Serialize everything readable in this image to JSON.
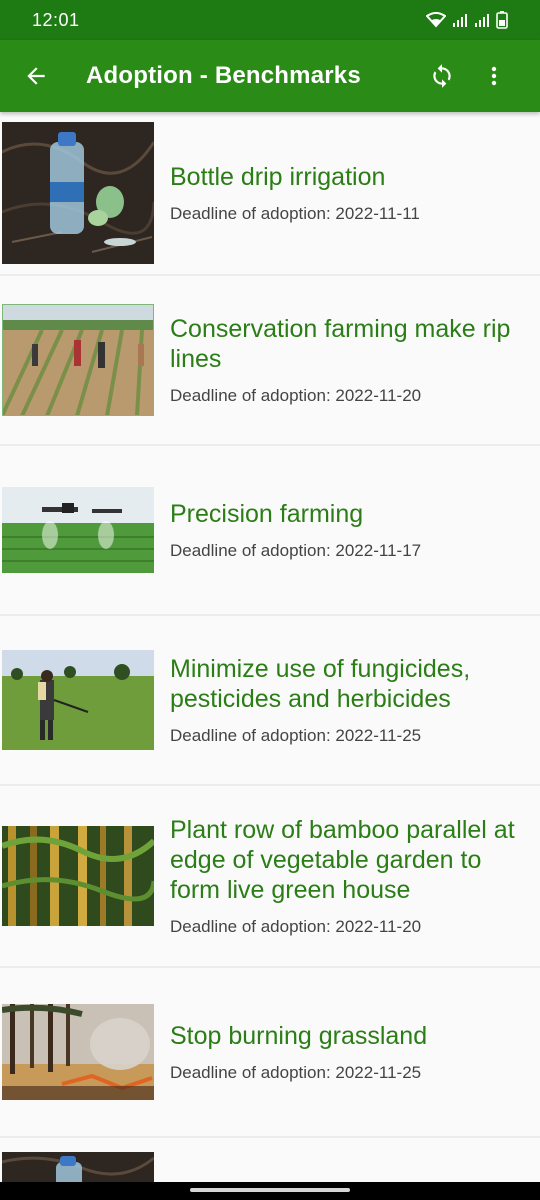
{
  "status_bar": {
    "time": "12:01",
    "icons": [
      "wifi-icon",
      "signal-icon",
      "signal-icon",
      "battery-icon"
    ]
  },
  "app_bar": {
    "title": "Adoption - Benchmarks",
    "back_icon": "arrow-back-icon",
    "refresh_icon": "refresh-icon",
    "more_icon": "more-vert-icon"
  },
  "colors": {
    "status_bar": "#1e7a12",
    "app_bar": "#2a8c17",
    "title_text": "#2b7d16",
    "deadline_text": "#444444",
    "background": "#fafafa"
  },
  "benchmarks": [
    {
      "title": "Bottle drip irrigation",
      "deadline": "Deadline of adoption: 2022-11-11"
    },
    {
      "title": "Conservation farming make rip lines",
      "deadline": "Deadline of adoption: 2022-11-20"
    },
    {
      "title": "Precision farming",
      "deadline": "Deadline of adoption: 2022-11-17"
    },
    {
      "title": "Minimize use of fungicides, pesticides and herbicides",
      "deadline": "Deadline of adoption: 2022-11-25"
    },
    {
      "title": "Plant row of bamboo parallel at edge of vegetable garden to form live green house",
      "deadline": "Deadline of adoption: 2022-11-20"
    },
    {
      "title": "Stop burning grassland",
      "deadline": "Deadline of adoption: 2022-11-25"
    }
  ]
}
